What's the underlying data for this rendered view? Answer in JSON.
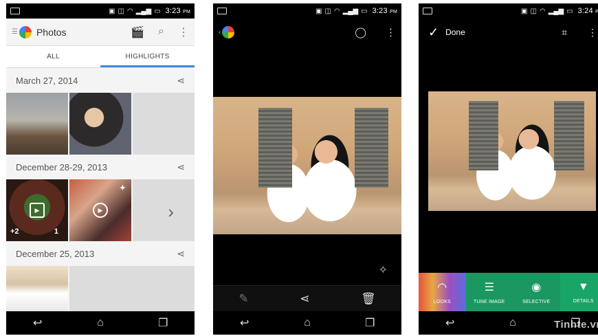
{
  "status": {
    "time_1": "3:23",
    "time_2": "3:23",
    "time_3": "3:24",
    "ampm": "PM"
  },
  "gallery": {
    "app_title": "Photos",
    "tabs": [
      {
        "label": "ALL"
      },
      {
        "label": "HIGHLIGHTS"
      }
    ],
    "sections": [
      {
        "date": "March 27, 2014"
      },
      {
        "date": "December 28-29, 2013",
        "more_count": "+2",
        "comment_count": "1"
      },
      {
        "date": "December 25, 2013"
      }
    ]
  },
  "editor": {
    "done_label": "Done",
    "tools": [
      {
        "label": "LOOKS"
      },
      {
        "label": "TUNE IMAGE"
      },
      {
        "label": "SELECTIVE"
      },
      {
        "label": "DETAILS"
      }
    ]
  },
  "watermark": "Tinhte.vn",
  "icons": {
    "share": "share-icon",
    "menu": "overflow-menu-icon",
    "search": "search-icon",
    "movie": "movie-maker-icon"
  },
  "colors": {
    "tab_underline": "#3f8bdf",
    "editor_green": "#1b9861"
  }
}
